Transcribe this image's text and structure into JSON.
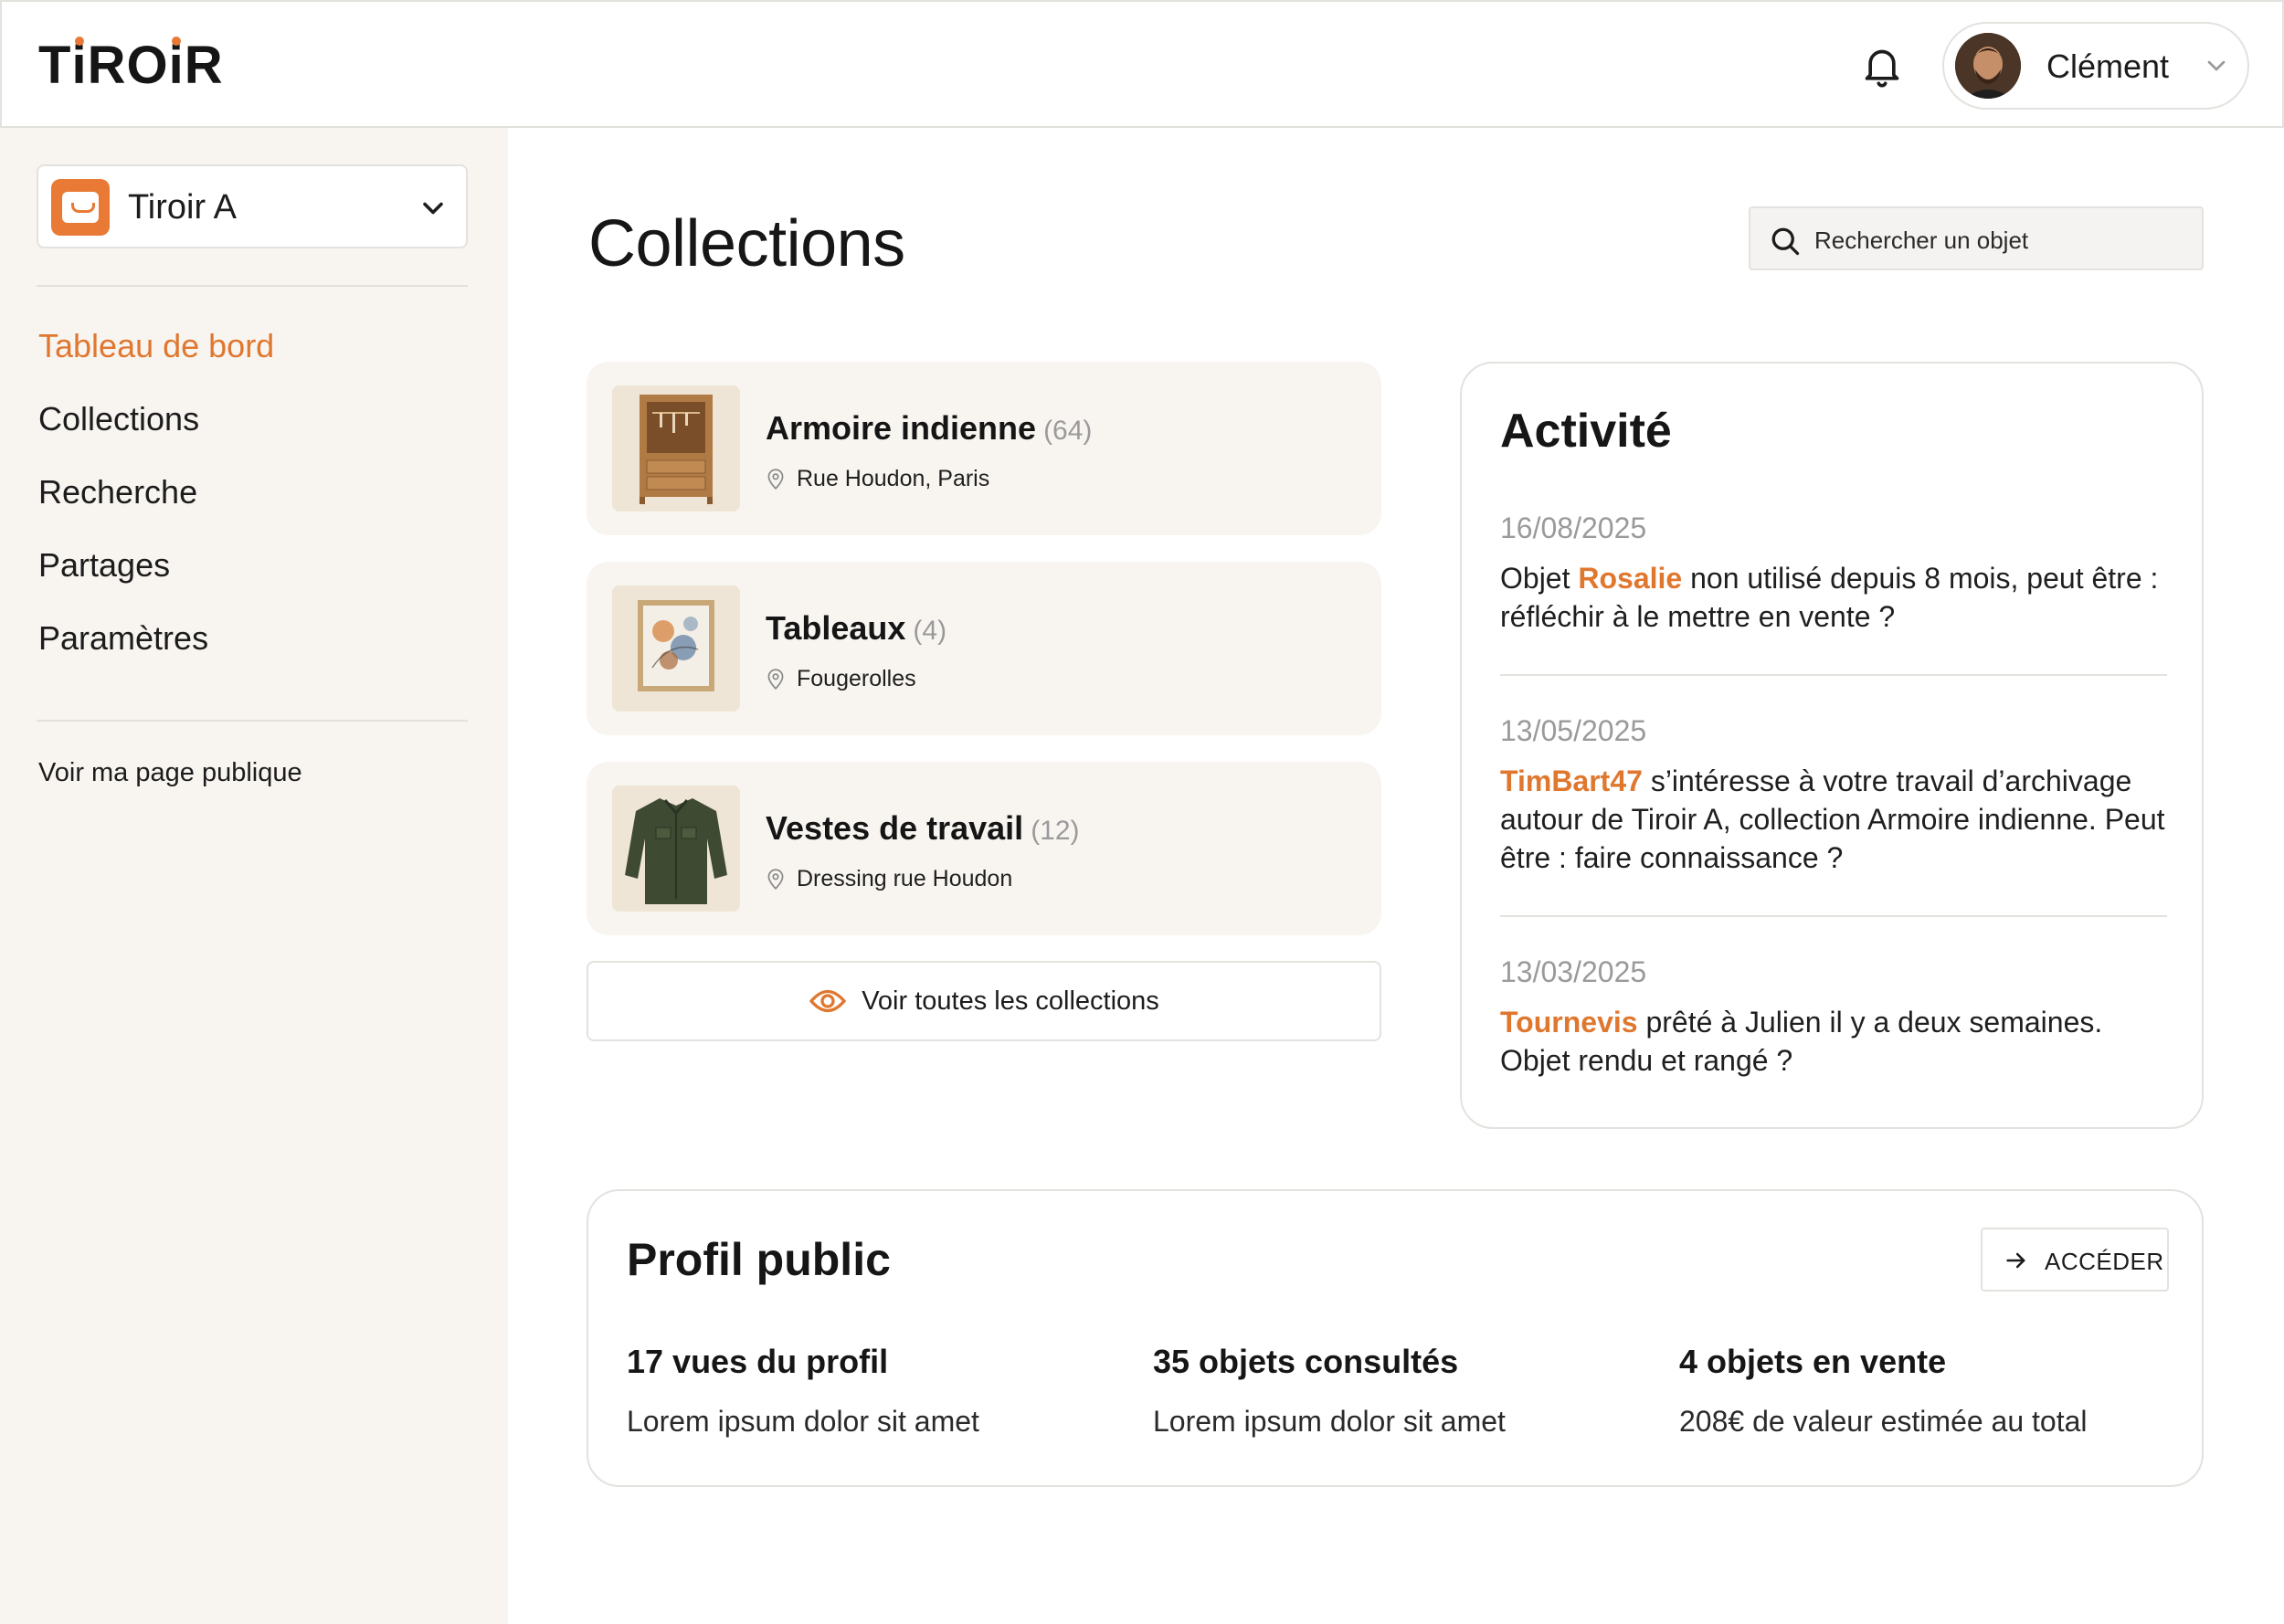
{
  "header": {
    "logo": "TiROiR",
    "logo_parts": [
      "T",
      "i",
      "RO",
      "i",
      "R"
    ],
    "user_name": "Clément",
    "icons": {
      "bell": "bell-icon",
      "chevron": "chevron-down-icon"
    }
  },
  "sidebar": {
    "drawer_selector": {
      "label": "Tiroir A",
      "icon": "drawer-icon"
    },
    "nav": [
      {
        "label": "Tableau de bord",
        "active": true
      },
      {
        "label": "Collections",
        "active": false
      },
      {
        "label": "Recherche",
        "active": false
      },
      {
        "label": "Partages",
        "active": false
      },
      {
        "label": "Paramètres",
        "active": false
      }
    ],
    "public_page_link": "Voir ma page publique"
  },
  "main": {
    "title": "Collections",
    "search": {
      "placeholder": "Rechercher un objet",
      "icon": "search-icon"
    },
    "collections": [
      {
        "name": "Armoire indienne",
        "count": "(64)",
        "location": "Rue Houdon, Paris",
        "thumb": "wardrobe"
      },
      {
        "name": "Tableaux",
        "count": "(4)",
        "location": "Fougerolles",
        "thumb": "painting"
      },
      {
        "name": "Vestes de travail",
        "count": "(12)",
        "location": "Dressing rue Houdon",
        "thumb": "jacket"
      }
    ],
    "see_all_label": "Voir toutes les collections"
  },
  "activity": {
    "title": "Activité",
    "items": [
      {
        "date": "16/08/2025",
        "prefix": "Objet ",
        "highlight": "Rosalie",
        "suffix": " non utilisé depuis 8 mois, peut être : réfléchir à le mettre en vente ?"
      },
      {
        "date": "13/05/2025",
        "prefix": "",
        "highlight": "TimBart47",
        "suffix": " s’intéresse à votre travail d’archivage autour de Tiroir A, collection Armoire indienne. Peut être : faire connaissance ?"
      },
      {
        "date": "13/03/2025",
        "prefix": "",
        "highlight": "Tournevis",
        "suffix": " prêté à Julien il y a deux semaines. Objet rendu et rangé ?"
      }
    ]
  },
  "profile": {
    "title": "Profil public",
    "access_label": "ACCÉDER",
    "stats": [
      {
        "value": "17 vues du profil",
        "desc": "Lorem ipsum dolor sit amet"
      },
      {
        "value": "35 objets consultés",
        "desc": "Lorem ipsum dolor sit amet"
      },
      {
        "value": "4 objets en vente",
        "desc": "208€ de valeur estimée au total"
      }
    ]
  },
  "colors": {
    "accent": "#e0772f",
    "sidebar_bg": "#f8f5f1",
    "card_bg": "#f8f5f1",
    "border": "#e4e2de",
    "muted": "#9a9a9a"
  }
}
